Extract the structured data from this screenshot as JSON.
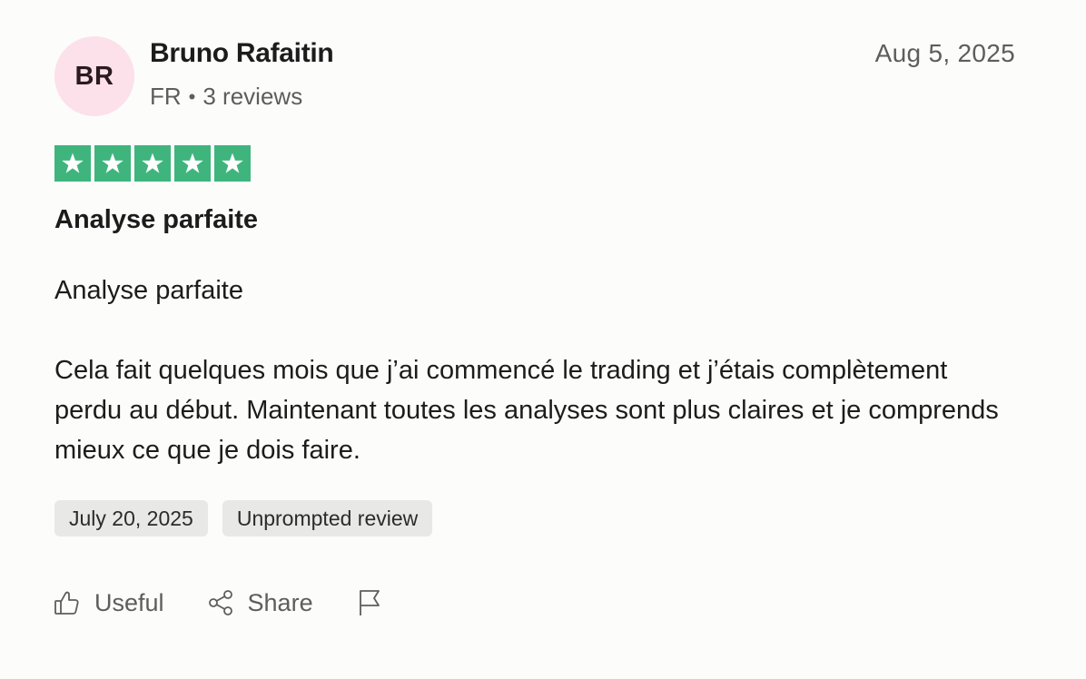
{
  "author": {
    "initials": "BR",
    "name": "Bruno Rafaitin",
    "country": "FR",
    "reviews": "3 reviews"
  },
  "review": {
    "date_posted": "Aug 5, 2025",
    "rating": 5,
    "rating_max": 5,
    "title": "Analyse parfaite",
    "body": [
      "Analyse parfaite",
      "Cela fait quelques mois que j’ai commencé le trading et j’étais complètement perdu au début. Maintenant toutes les analyses sont plus claires et je comprends mieux ce que je dois faire."
    ],
    "experience_date": "July 20, 2025",
    "label": "Unprompted review"
  },
  "actions": {
    "useful": "Useful",
    "share": "Share"
  },
  "colors": {
    "star_green": "#3fb57d",
    "avatar_bg": "#fce0ea",
    "tag_bg": "#e8e8e6"
  },
  "icons": [
    "star-icon",
    "thumbs-up-icon",
    "share-icon",
    "flag-icon"
  ]
}
